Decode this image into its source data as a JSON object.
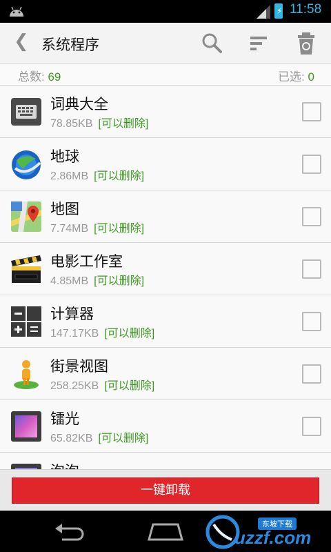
{
  "status_bar": {
    "time": "11:58",
    "icons": [
      "android-icon",
      "signal-icon",
      "battery-charging-icon"
    ]
  },
  "action_bar": {
    "title": "系统程序",
    "actions": [
      "search-icon",
      "sort-icon",
      "recycle-bin-icon"
    ]
  },
  "counts": {
    "total_label": "总数:",
    "total_value": "69",
    "selected_label": "已选:",
    "selected_value": "0"
  },
  "apps": [
    {
      "name": "词典大全",
      "size": "78.85KB",
      "tag": "[可以删除]",
      "icon": "keyboard-icon",
      "checked": false
    },
    {
      "name": "地球",
      "size": "2.86MB",
      "tag": "[可以删除]",
      "icon": "google-earth-icon",
      "checked": false
    },
    {
      "name": "地图",
      "size": "7.74MB",
      "tag": "[可以删除]",
      "icon": "maps-icon",
      "checked": false
    },
    {
      "name": "电影工作室",
      "size": "4.85MB",
      "tag": "[可以删除]",
      "icon": "clapperboard-icon",
      "checked": false
    },
    {
      "name": "计算器",
      "size": "147.17KB",
      "tag": "[可以删除]",
      "icon": "calculator-icon",
      "checked": false
    },
    {
      "name": "街景视图",
      "size": "258.25KB",
      "tag": "[可以删除]",
      "icon": "street-view-icon",
      "checked": false
    },
    {
      "name": "镭光",
      "size": "65.82KB",
      "tag": "[可以删除]",
      "icon": "wallpaper-icon",
      "checked": false
    },
    {
      "name": "泡泡",
      "size": "",
      "tag": "",
      "icon": "wallpaper-icon",
      "checked": false
    }
  ],
  "bottom": {
    "uninstall_label": "一键卸载"
  },
  "watermark": {
    "text": "uzzf.com",
    "sub": "东坡下载"
  },
  "colors": {
    "accent_green": "#3b9c1e",
    "button_red": "#e0262b",
    "status_blue": "#33b5e5"
  }
}
